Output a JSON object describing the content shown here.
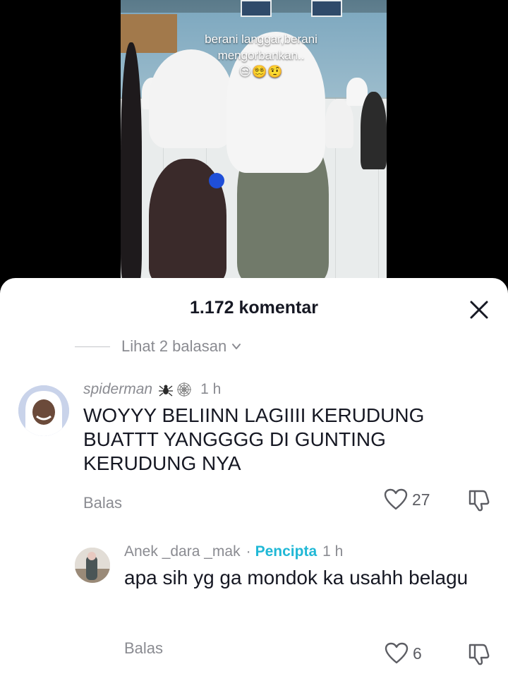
{
  "video": {
    "caption_line1": "berani langgar,berani",
    "caption_line2": "mengorbankan..",
    "caption_emojis": "😒😵‍💫🤨"
  },
  "sheet": {
    "title": "1.172 komentar",
    "view_replies": "Lihat 2 balasan"
  },
  "comments": [
    {
      "username": "spiderman",
      "time": "1 h",
      "text": "WOYYY BELIINN LAGIIII KERUDUNG BUATTT YANGGGG DI GUNTING KERUDUNG NYA",
      "reply_label": "Balas",
      "likes": "27"
    },
    {
      "username": "Anek _dara _mak",
      "separator": "·",
      "badge": "Pencipta",
      "time": "1 h",
      "text": "apa sih yg ga mondok ka usahh belagu",
      "reply_label": "Balas",
      "likes": "6"
    }
  ],
  "icons": {
    "close": "close-icon",
    "chevron": "chevron-down-icon",
    "like": "heart-icon",
    "dislike": "thumbs-down-icon",
    "decorations": [
      "spider-icon",
      "spider-web-icon"
    ]
  },
  "colors": {
    "accent_creator": "#20b8d6",
    "muted_text": "#8a8b91",
    "primary_text": "#161823"
  }
}
